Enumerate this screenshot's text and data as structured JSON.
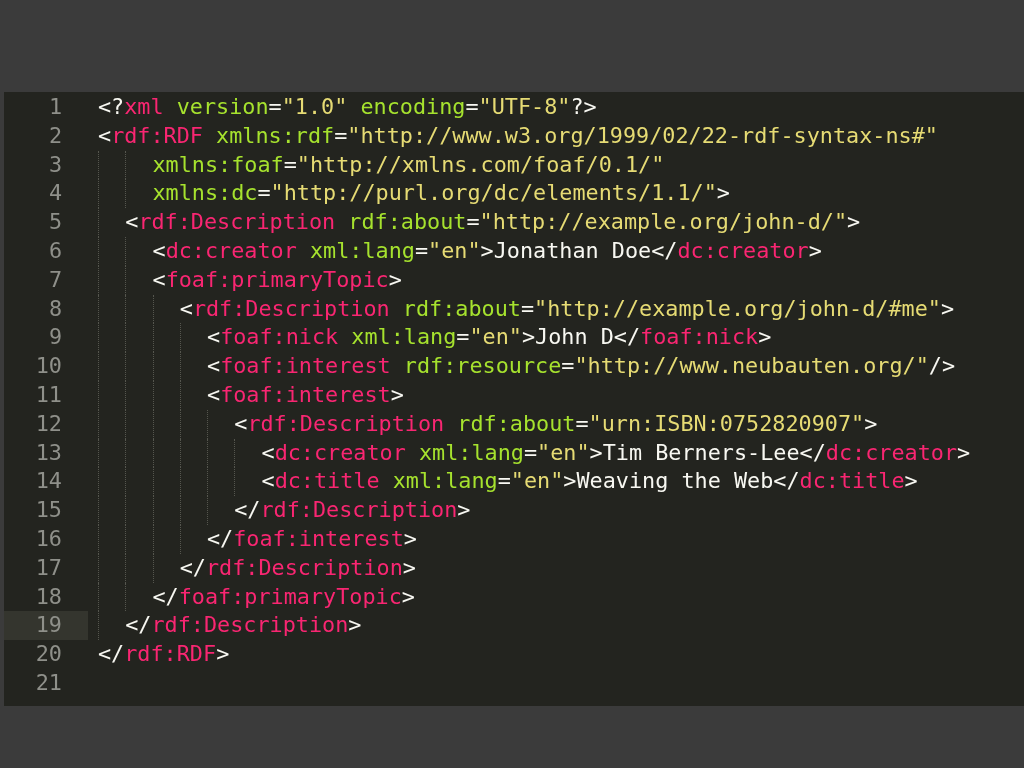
{
  "editor": {
    "lines": [
      {
        "number": "1",
        "current": false,
        "tokens": [
          {
            "kind": "punct",
            "text": "<?"
          },
          {
            "kind": "tag",
            "text": "xml"
          },
          {
            "kind": "attr",
            "text": " version"
          },
          {
            "kind": "punct",
            "text": "="
          },
          {
            "kind": "string",
            "text": "\"1.0\""
          },
          {
            "kind": "attr",
            "text": " encoding"
          },
          {
            "kind": "punct",
            "text": "="
          },
          {
            "kind": "string",
            "text": "\"UTF-8\""
          },
          {
            "kind": "punct",
            "text": "?>"
          }
        ]
      },
      {
        "number": "2",
        "current": false,
        "tokens": [
          {
            "kind": "punct",
            "text": "<"
          },
          {
            "kind": "tag",
            "text": "rdf:RDF"
          },
          {
            "kind": "attr",
            "text": " xmlns:rdf"
          },
          {
            "kind": "punct",
            "text": "="
          },
          {
            "kind": "string",
            "text": "\"http://www.w3.org/1999/02/22-rdf-syntax-ns#\""
          }
        ]
      },
      {
        "number": "3",
        "current": false,
        "tokens": [
          {
            "kind": "attr",
            "text": "    xmlns:foaf"
          },
          {
            "kind": "punct",
            "text": "="
          },
          {
            "kind": "string",
            "text": "\"http://xmlns.com/foaf/0.1/\""
          }
        ]
      },
      {
        "number": "4",
        "current": false,
        "tokens": [
          {
            "kind": "attr",
            "text": "    xmlns:dc"
          },
          {
            "kind": "punct",
            "text": "="
          },
          {
            "kind": "string",
            "text": "\"http://purl.org/dc/elements/1.1/\""
          },
          {
            "kind": "punct",
            "text": ">"
          }
        ]
      },
      {
        "number": "5",
        "current": false,
        "tokens": [
          {
            "kind": "punct",
            "text": "  <"
          },
          {
            "kind": "tag",
            "text": "rdf:Description"
          },
          {
            "kind": "attr",
            "text": " rdf:about"
          },
          {
            "kind": "punct",
            "text": "="
          },
          {
            "kind": "string",
            "text": "\"http://example.org/john-d/\""
          },
          {
            "kind": "punct",
            "text": ">"
          }
        ]
      },
      {
        "number": "6",
        "current": false,
        "tokens": [
          {
            "kind": "punct",
            "text": "    <"
          },
          {
            "kind": "tag",
            "text": "dc:creator"
          },
          {
            "kind": "attr",
            "text": " xml:lang"
          },
          {
            "kind": "punct",
            "text": "="
          },
          {
            "kind": "string",
            "text": "\"en\""
          },
          {
            "kind": "punct",
            "text": ">"
          },
          {
            "kind": "text",
            "text": "Jonathan Doe"
          },
          {
            "kind": "punct",
            "text": "</"
          },
          {
            "kind": "tag",
            "text": "dc:creator"
          },
          {
            "kind": "punct",
            "text": ">"
          }
        ]
      },
      {
        "number": "7",
        "current": false,
        "tokens": [
          {
            "kind": "punct",
            "text": "    <"
          },
          {
            "kind": "tag",
            "text": "foaf:primaryTopic"
          },
          {
            "kind": "punct",
            "text": ">"
          }
        ]
      },
      {
        "number": "8",
        "current": false,
        "tokens": [
          {
            "kind": "punct",
            "text": "      <"
          },
          {
            "kind": "tag",
            "text": "rdf:Description"
          },
          {
            "kind": "attr",
            "text": " rdf:about"
          },
          {
            "kind": "punct",
            "text": "="
          },
          {
            "kind": "string",
            "text": "\"http://example.org/john-d/#me\""
          },
          {
            "kind": "punct",
            "text": ">"
          }
        ]
      },
      {
        "number": "9",
        "current": false,
        "tokens": [
          {
            "kind": "punct",
            "text": "        <"
          },
          {
            "kind": "tag",
            "text": "foaf:nick"
          },
          {
            "kind": "attr",
            "text": " xml:lang"
          },
          {
            "kind": "punct",
            "text": "="
          },
          {
            "kind": "string",
            "text": "\"en\""
          },
          {
            "kind": "punct",
            "text": ">"
          },
          {
            "kind": "text",
            "text": "John D"
          },
          {
            "kind": "punct",
            "text": "</"
          },
          {
            "kind": "tag",
            "text": "foaf:nick"
          },
          {
            "kind": "punct",
            "text": ">"
          }
        ]
      },
      {
        "number": "10",
        "current": false,
        "tokens": [
          {
            "kind": "punct",
            "text": "        <"
          },
          {
            "kind": "tag",
            "text": "foaf:interest"
          },
          {
            "kind": "attr",
            "text": " rdf:resource"
          },
          {
            "kind": "punct",
            "text": "="
          },
          {
            "kind": "string",
            "text": "\"http://www.neubauten.org/\""
          },
          {
            "kind": "punct",
            "text": "/>"
          }
        ]
      },
      {
        "number": "11",
        "current": false,
        "tokens": [
          {
            "kind": "punct",
            "text": "        <"
          },
          {
            "kind": "tag",
            "text": "foaf:interest"
          },
          {
            "kind": "punct",
            "text": ">"
          }
        ]
      },
      {
        "number": "12",
        "current": false,
        "tokens": [
          {
            "kind": "punct",
            "text": "          <"
          },
          {
            "kind": "tag",
            "text": "rdf:Description"
          },
          {
            "kind": "attr",
            "text": " rdf:about"
          },
          {
            "kind": "punct",
            "text": "="
          },
          {
            "kind": "string",
            "text": "\"urn:ISBN:0752820907\""
          },
          {
            "kind": "punct",
            "text": ">"
          }
        ]
      },
      {
        "number": "13",
        "current": false,
        "tokens": [
          {
            "kind": "punct",
            "text": "            <"
          },
          {
            "kind": "tag",
            "text": "dc:creator"
          },
          {
            "kind": "attr",
            "text": " xml:lang"
          },
          {
            "kind": "punct",
            "text": "="
          },
          {
            "kind": "string",
            "text": "\"en\""
          },
          {
            "kind": "punct",
            "text": ">"
          },
          {
            "kind": "text",
            "text": "Tim Berners-Lee"
          },
          {
            "kind": "punct",
            "text": "</"
          },
          {
            "kind": "tag",
            "text": "dc:creator"
          },
          {
            "kind": "punct",
            "text": ">"
          }
        ]
      },
      {
        "number": "14",
        "current": false,
        "tokens": [
          {
            "kind": "punct",
            "text": "            <"
          },
          {
            "kind": "tag",
            "text": "dc:title"
          },
          {
            "kind": "attr",
            "text": " xml:lang"
          },
          {
            "kind": "punct",
            "text": "="
          },
          {
            "kind": "string",
            "text": "\"en\""
          },
          {
            "kind": "punct",
            "text": ">"
          },
          {
            "kind": "text",
            "text": "Weaving the Web"
          },
          {
            "kind": "punct",
            "text": "</"
          },
          {
            "kind": "tag",
            "text": "dc:title"
          },
          {
            "kind": "punct",
            "text": ">"
          }
        ]
      },
      {
        "number": "15",
        "current": false,
        "tokens": [
          {
            "kind": "punct",
            "text": "          </"
          },
          {
            "kind": "tag",
            "text": "rdf:Description"
          },
          {
            "kind": "punct",
            "text": ">"
          }
        ]
      },
      {
        "number": "16",
        "current": false,
        "tokens": [
          {
            "kind": "punct",
            "text": "        </"
          },
          {
            "kind": "tag",
            "text": "foaf:interest"
          },
          {
            "kind": "punct",
            "text": ">"
          }
        ]
      },
      {
        "number": "17",
        "current": false,
        "tokens": [
          {
            "kind": "punct",
            "text": "      </"
          },
          {
            "kind": "tag",
            "text": "rdf:Description"
          },
          {
            "kind": "punct",
            "text": ">"
          }
        ]
      },
      {
        "number": "18",
        "current": false,
        "tokens": [
          {
            "kind": "punct",
            "text": "    </"
          },
          {
            "kind": "tag",
            "text": "foaf:primaryTopic"
          },
          {
            "kind": "punct",
            "text": ">"
          }
        ]
      },
      {
        "number": "19",
        "current": true,
        "tokens": [
          {
            "kind": "punct",
            "text": "  </"
          },
          {
            "kind": "tag",
            "text": "rdf:Description"
          },
          {
            "kind": "punct",
            "text": ">"
          }
        ]
      },
      {
        "number": "20",
        "current": false,
        "tokens": [
          {
            "kind": "punct",
            "text": "</"
          },
          {
            "kind": "tag",
            "text": "rdf:RDF"
          },
          {
            "kind": "punct",
            "text": ">"
          }
        ]
      },
      {
        "number": "21",
        "current": false
      }
    ]
  }
}
